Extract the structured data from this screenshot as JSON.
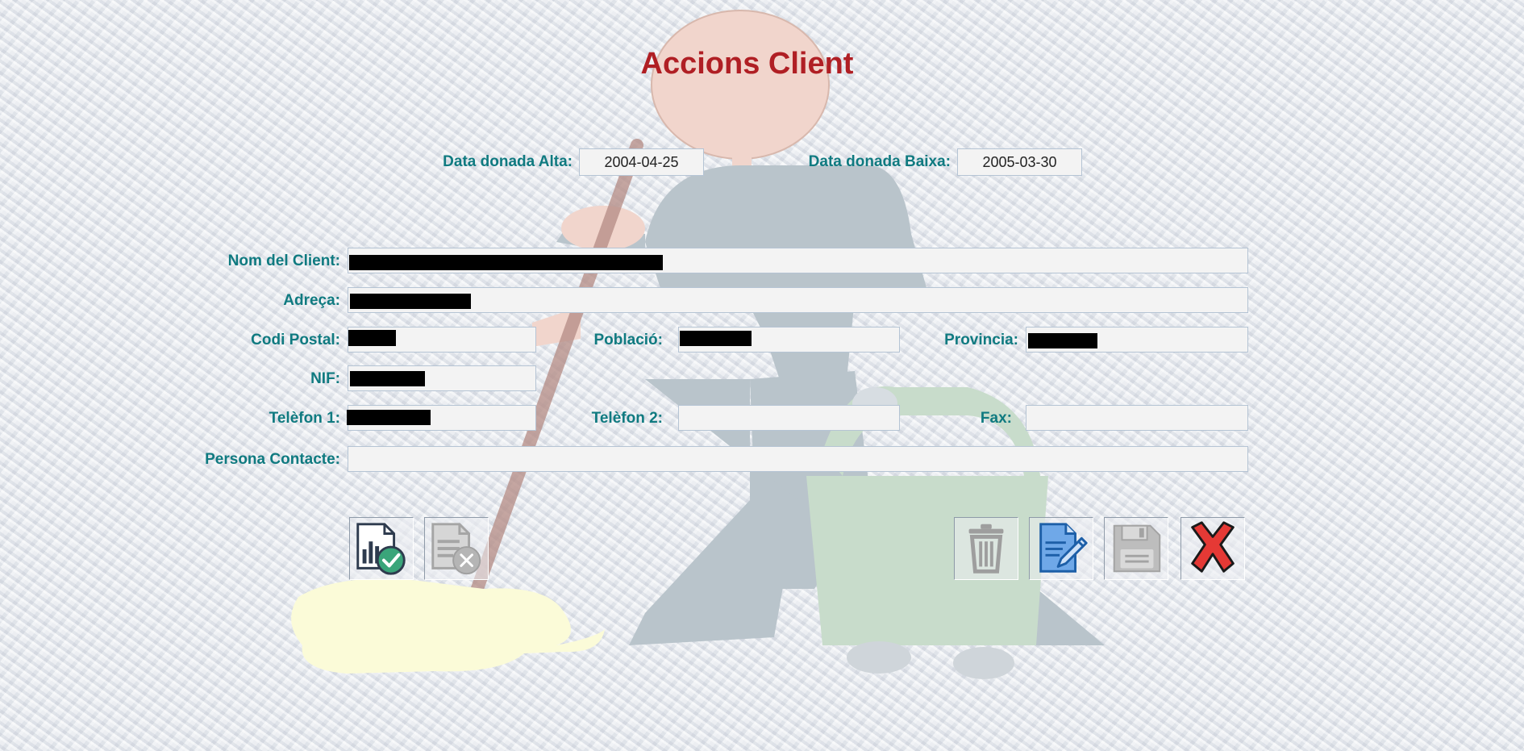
{
  "page": {
    "title": "Accions Client"
  },
  "dates": {
    "alta_label": "Data donada Alta:",
    "alta_value": "2004-04-25",
    "baixa_label": "Data donada Baixa:",
    "baixa_value": "2005-03-30"
  },
  "form": {
    "nom_label": "Nom del Client:",
    "nom_value": "",
    "adreca_label": "Adreça:",
    "adreca_value": "",
    "codi_postal_label": "Codi Postal:",
    "codi_postal_value": "",
    "poblacio_label": "Població:",
    "poblacio_value": "",
    "provincia_label": "Provincia:",
    "provincia_value": "",
    "nif_label": "NIF:",
    "nif_value": "",
    "telefon1_label": "Telèfon 1:",
    "telefon1_value": "",
    "telefon2_label": "Telèfon 2:",
    "telefon2_value": "",
    "fax_label": "Fax:",
    "fax_value": "",
    "contacte_label": "Persona Contacte:",
    "contacte_value": ""
  },
  "buttons": [
    {
      "icon": "report-approve-icon",
      "enabled": true
    },
    {
      "icon": "report-cancel-icon",
      "enabled": false
    },
    {
      "icon": "trash-icon",
      "enabled": false
    },
    {
      "icon": "edit-document-icon",
      "enabled": true
    },
    {
      "icon": "save-icon",
      "enabled": false
    },
    {
      "icon": "close-icon",
      "enabled": true
    }
  ],
  "colors": {
    "title": "#b01f24",
    "label": "#0f7a80",
    "field_background": "#f3f3f3",
    "close_red": "#e53935"
  }
}
